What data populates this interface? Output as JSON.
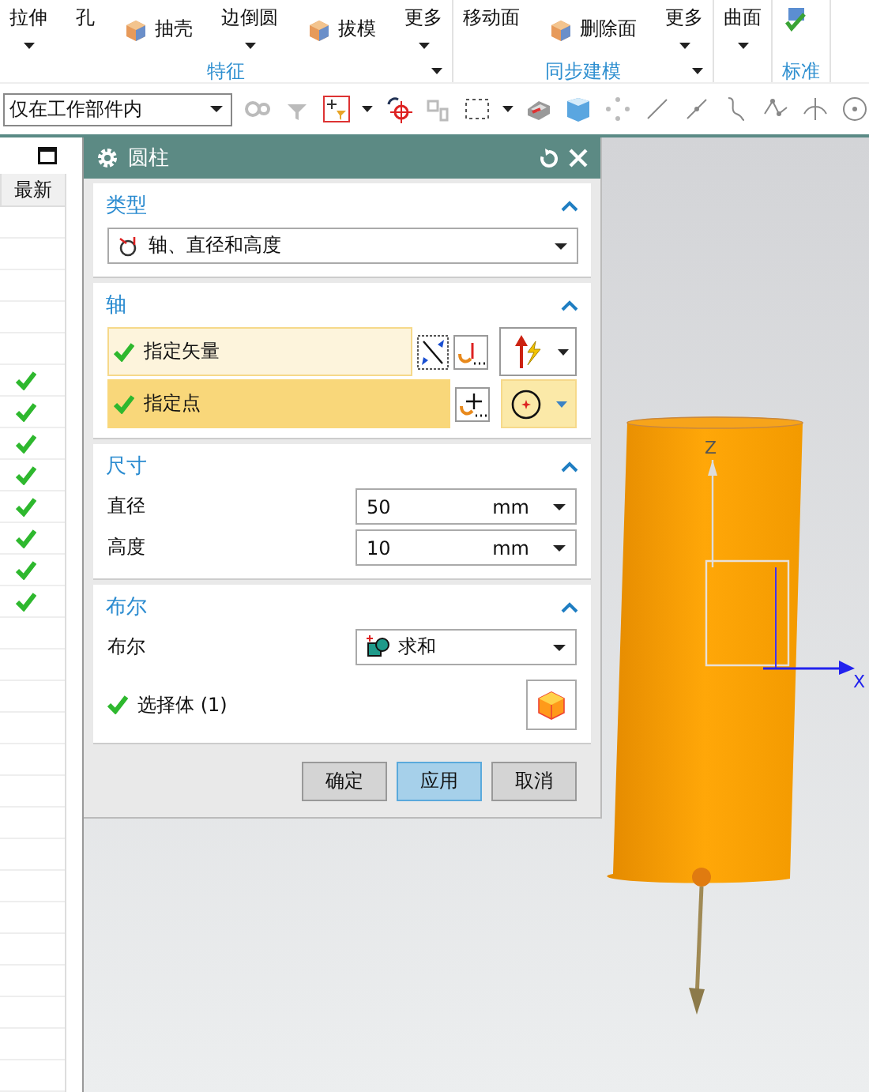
{
  "ribbon": {
    "groups": [
      {
        "label": "特征",
        "launcher": true,
        "tools": [
          {
            "label": "拉伸",
            "kind": "large",
            "caret": true
          },
          {
            "label": "孔",
            "kind": "large",
            "caret": false
          },
          {
            "label": "抽壳",
            "kind": "small"
          },
          {
            "label": "边倒圆",
            "kind": "large",
            "caret": true
          },
          {
            "label": "拔模",
            "kind": "small"
          },
          {
            "label": "更多",
            "kind": "large",
            "caret": true
          }
        ]
      },
      {
        "label": "同步建模",
        "launcher": true,
        "tools": [
          {
            "label": "移动面",
            "kind": "large",
            "caret": false
          },
          {
            "label": "删除面",
            "kind": "small"
          },
          {
            "label": "更多",
            "kind": "large",
            "caret": true
          }
        ]
      },
      {
        "launcher": false,
        "tools": [
          {
            "label": "曲面",
            "kind": "large",
            "caret": true
          }
        ]
      },
      {
        "label": "标准",
        "launcher": false,
        "tools": [
          {
            "kind": "icon"
          }
        ]
      }
    ]
  },
  "toolbar": {
    "scope": "仅在工作部件内"
  },
  "part_navigator": {
    "column": "最新",
    "rows": [
      {
        "checked": false
      },
      {
        "checked": false
      },
      {
        "checked": false
      },
      {
        "checked": false
      },
      {
        "checked": false
      },
      {
        "checked": true
      },
      {
        "checked": true
      },
      {
        "checked": true
      },
      {
        "checked": true
      },
      {
        "checked": true
      },
      {
        "checked": true
      },
      {
        "checked": true
      },
      {
        "checked": true
      },
      {
        "checked": false
      },
      {
        "checked": false
      },
      {
        "checked": false
      },
      {
        "checked": false
      },
      {
        "checked": false
      },
      {
        "checked": false
      },
      {
        "checked": false
      },
      {
        "checked": false
      },
      {
        "checked": false
      },
      {
        "checked": false
      },
      {
        "checked": false
      },
      {
        "checked": false
      },
      {
        "checked": false
      },
      {
        "checked": false
      },
      {
        "checked": false
      }
    ]
  },
  "dialog": {
    "title": "圆柱",
    "type_section": {
      "title": "类型",
      "expanded": true,
      "value": "轴、直径和高度"
    },
    "axis_section": {
      "title": "轴",
      "expanded": true,
      "rows": [
        {
          "label": "指定矢量",
          "done": true,
          "selected": false
        },
        {
          "label": "指定点",
          "done": true,
          "selected": true
        }
      ]
    },
    "size_section": {
      "title": "尺寸",
      "expanded": true,
      "fields": [
        {
          "label": "直径",
          "value": "50",
          "unit": "mm"
        },
        {
          "label": "高度",
          "value": "10",
          "unit": "mm"
        }
      ]
    },
    "boolean_section": {
      "title": "布尔",
      "expanded": true,
      "label": "布尔",
      "value": "求和",
      "selection": {
        "label": "选择体 (1)",
        "done": true
      }
    },
    "buttons": [
      {
        "label": "确定",
        "selected": false
      },
      {
        "label": "应用",
        "selected": true
      },
      {
        "label": "取消",
        "selected": false
      }
    ]
  },
  "viewport": {
    "axis_labels": {
      "z": "Z",
      "x": "X"
    }
  }
}
